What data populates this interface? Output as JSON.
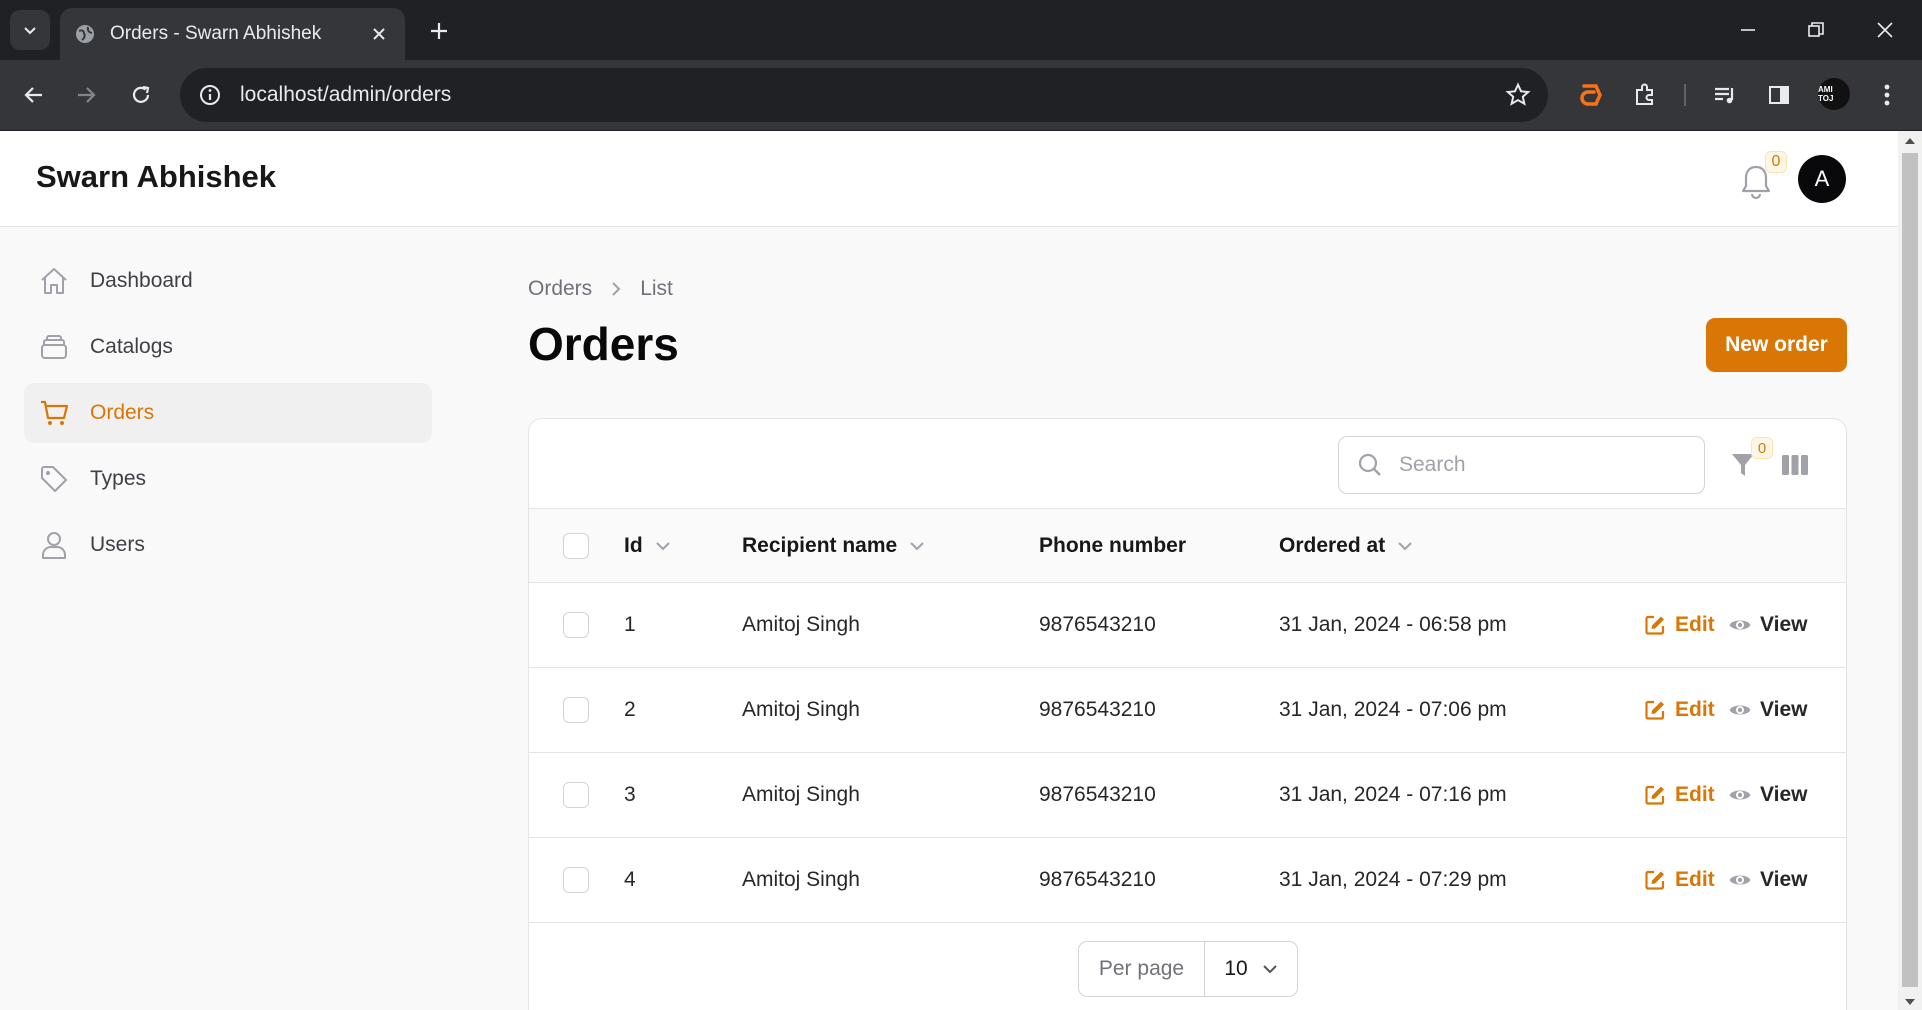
{
  "browser": {
    "tab_title": "Orders - Swarn Abhishek",
    "url": "localhost/admin/orders",
    "profile_chip": "AMI TOJ"
  },
  "app": {
    "brand": "Swarn Abhishek",
    "notification_count": "0",
    "avatar_initial": "A"
  },
  "sidebar": {
    "items": [
      {
        "label": "Dashboard",
        "icon": "home-icon",
        "active": false
      },
      {
        "label": "Catalogs",
        "icon": "stack-icon",
        "active": false
      },
      {
        "label": "Orders",
        "icon": "cart-icon",
        "active": true
      },
      {
        "label": "Types",
        "icon": "tag-icon",
        "active": false
      },
      {
        "label": "Users",
        "icon": "user-icon",
        "active": false
      }
    ]
  },
  "breadcrumb": {
    "root": "Orders",
    "current": "List"
  },
  "header": {
    "title": "Orders",
    "new_button": "New order"
  },
  "table": {
    "search_placeholder": "Search",
    "filter_count": "0",
    "columns": {
      "id": "Id",
      "recipient": "Recipient name",
      "phone": "Phone number",
      "ordered_at": "Ordered at"
    },
    "rows": [
      {
        "id": "1",
        "recipient": "Amitoj Singh",
        "phone": "9876543210",
        "ordered_at": "31 Jan, 2024 - 06:58 pm"
      },
      {
        "id": "2",
        "recipient": "Amitoj Singh",
        "phone": "9876543210",
        "ordered_at": "31 Jan, 2024 - 07:06 pm"
      },
      {
        "id": "3",
        "recipient": "Amitoj Singh",
        "phone": "9876543210",
        "ordered_at": "31 Jan, 2024 - 07:16 pm"
      },
      {
        "id": "4",
        "recipient": "Amitoj Singh",
        "phone": "9876543210",
        "ordered_at": "31 Jan, 2024 - 07:29 pm"
      }
    ],
    "edit_label": "Edit",
    "view_label": "View"
  },
  "pagination": {
    "per_page_label": "Per page",
    "per_page_value": "10"
  },
  "colors": {
    "accent": "#d97706",
    "chrome_dark": "#202124",
    "chrome": "#35363a"
  }
}
